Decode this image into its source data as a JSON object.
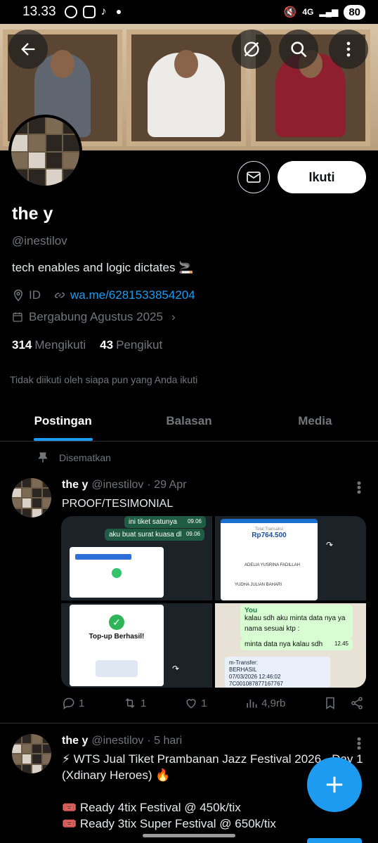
{
  "status_bar": {
    "time": "13.33",
    "network": "4G",
    "battery": "80"
  },
  "profile": {
    "follow_label": "Ikuti",
    "name": "the y",
    "handle": "@inestilov",
    "bio": "tech enables and logic dictates 🚬",
    "location": "ID",
    "website": "wa.me/6281533854204",
    "joined": "Bergabung Agustus 2025",
    "following_count": "314",
    "following_label": "Mengikuti",
    "followers_count": "43",
    "followers_label": "Pengikut",
    "mutual_text": "Tidak diikuti oleh siapa pun yang Anda ikuti"
  },
  "tabs": [
    {
      "label": "Postingan",
      "active": true
    },
    {
      "label": "Balasan",
      "active": false
    },
    {
      "label": "Media",
      "active": false
    }
  ],
  "pinned_label": "Disematkan",
  "tweets": [
    {
      "name": "the y",
      "handle": "@inestilov",
      "date": "· 29 Apr",
      "text": "PROOF/TESIMONIAL",
      "media": {
        "chat1": "ini tiket satunya",
        "time1": "09.06",
        "chat2": "aku buat surat kuasa dl",
        "time2": "09.06",
        "transfer_total_label": "Total Transaksi",
        "transfer_amount": "Rp764.500",
        "sender_name": "ADELIA YUSRINA FADILLAH",
        "recipient_name": "YUDHA JULIAN BAHARI",
        "topup_title": "Top-up Berhasil!",
        "you_label": "You",
        "quote_text": "kalau sdh aku minta data nya ya",
        "bullet_text": "nama sesuai ktp :",
        "reply_text": "minta data nya kalau sdh",
        "reply_time": "12.45",
        "mtransfer_title": "m-Transfer:",
        "mtransfer_status": "BERHASIL",
        "mtransfer_date": "07/03/2026 12:46:02",
        "mtransfer_ref": "7C001087877167767"
      },
      "replies": "1",
      "retweets": "1",
      "likes": "1",
      "views": "4,9rb"
    },
    {
      "name": "the y",
      "handle": "@inestilov",
      "date": "· 5 hari",
      "line1": "⚡ WTS Jual Tiket Prambanan Jazz Festival 2026 - Day 1",
      "line2": "(Xdinary Heroes) 🔥",
      "line3": "🎟️ Ready 4tix Festival @ 450k/tix",
      "line4": "🎟️ Ready 3tix Super Festival @ 650k/tix"
    }
  ],
  "colors": {
    "accent": "#1d9bf0",
    "background": "#000000",
    "muted": "#71767b"
  }
}
